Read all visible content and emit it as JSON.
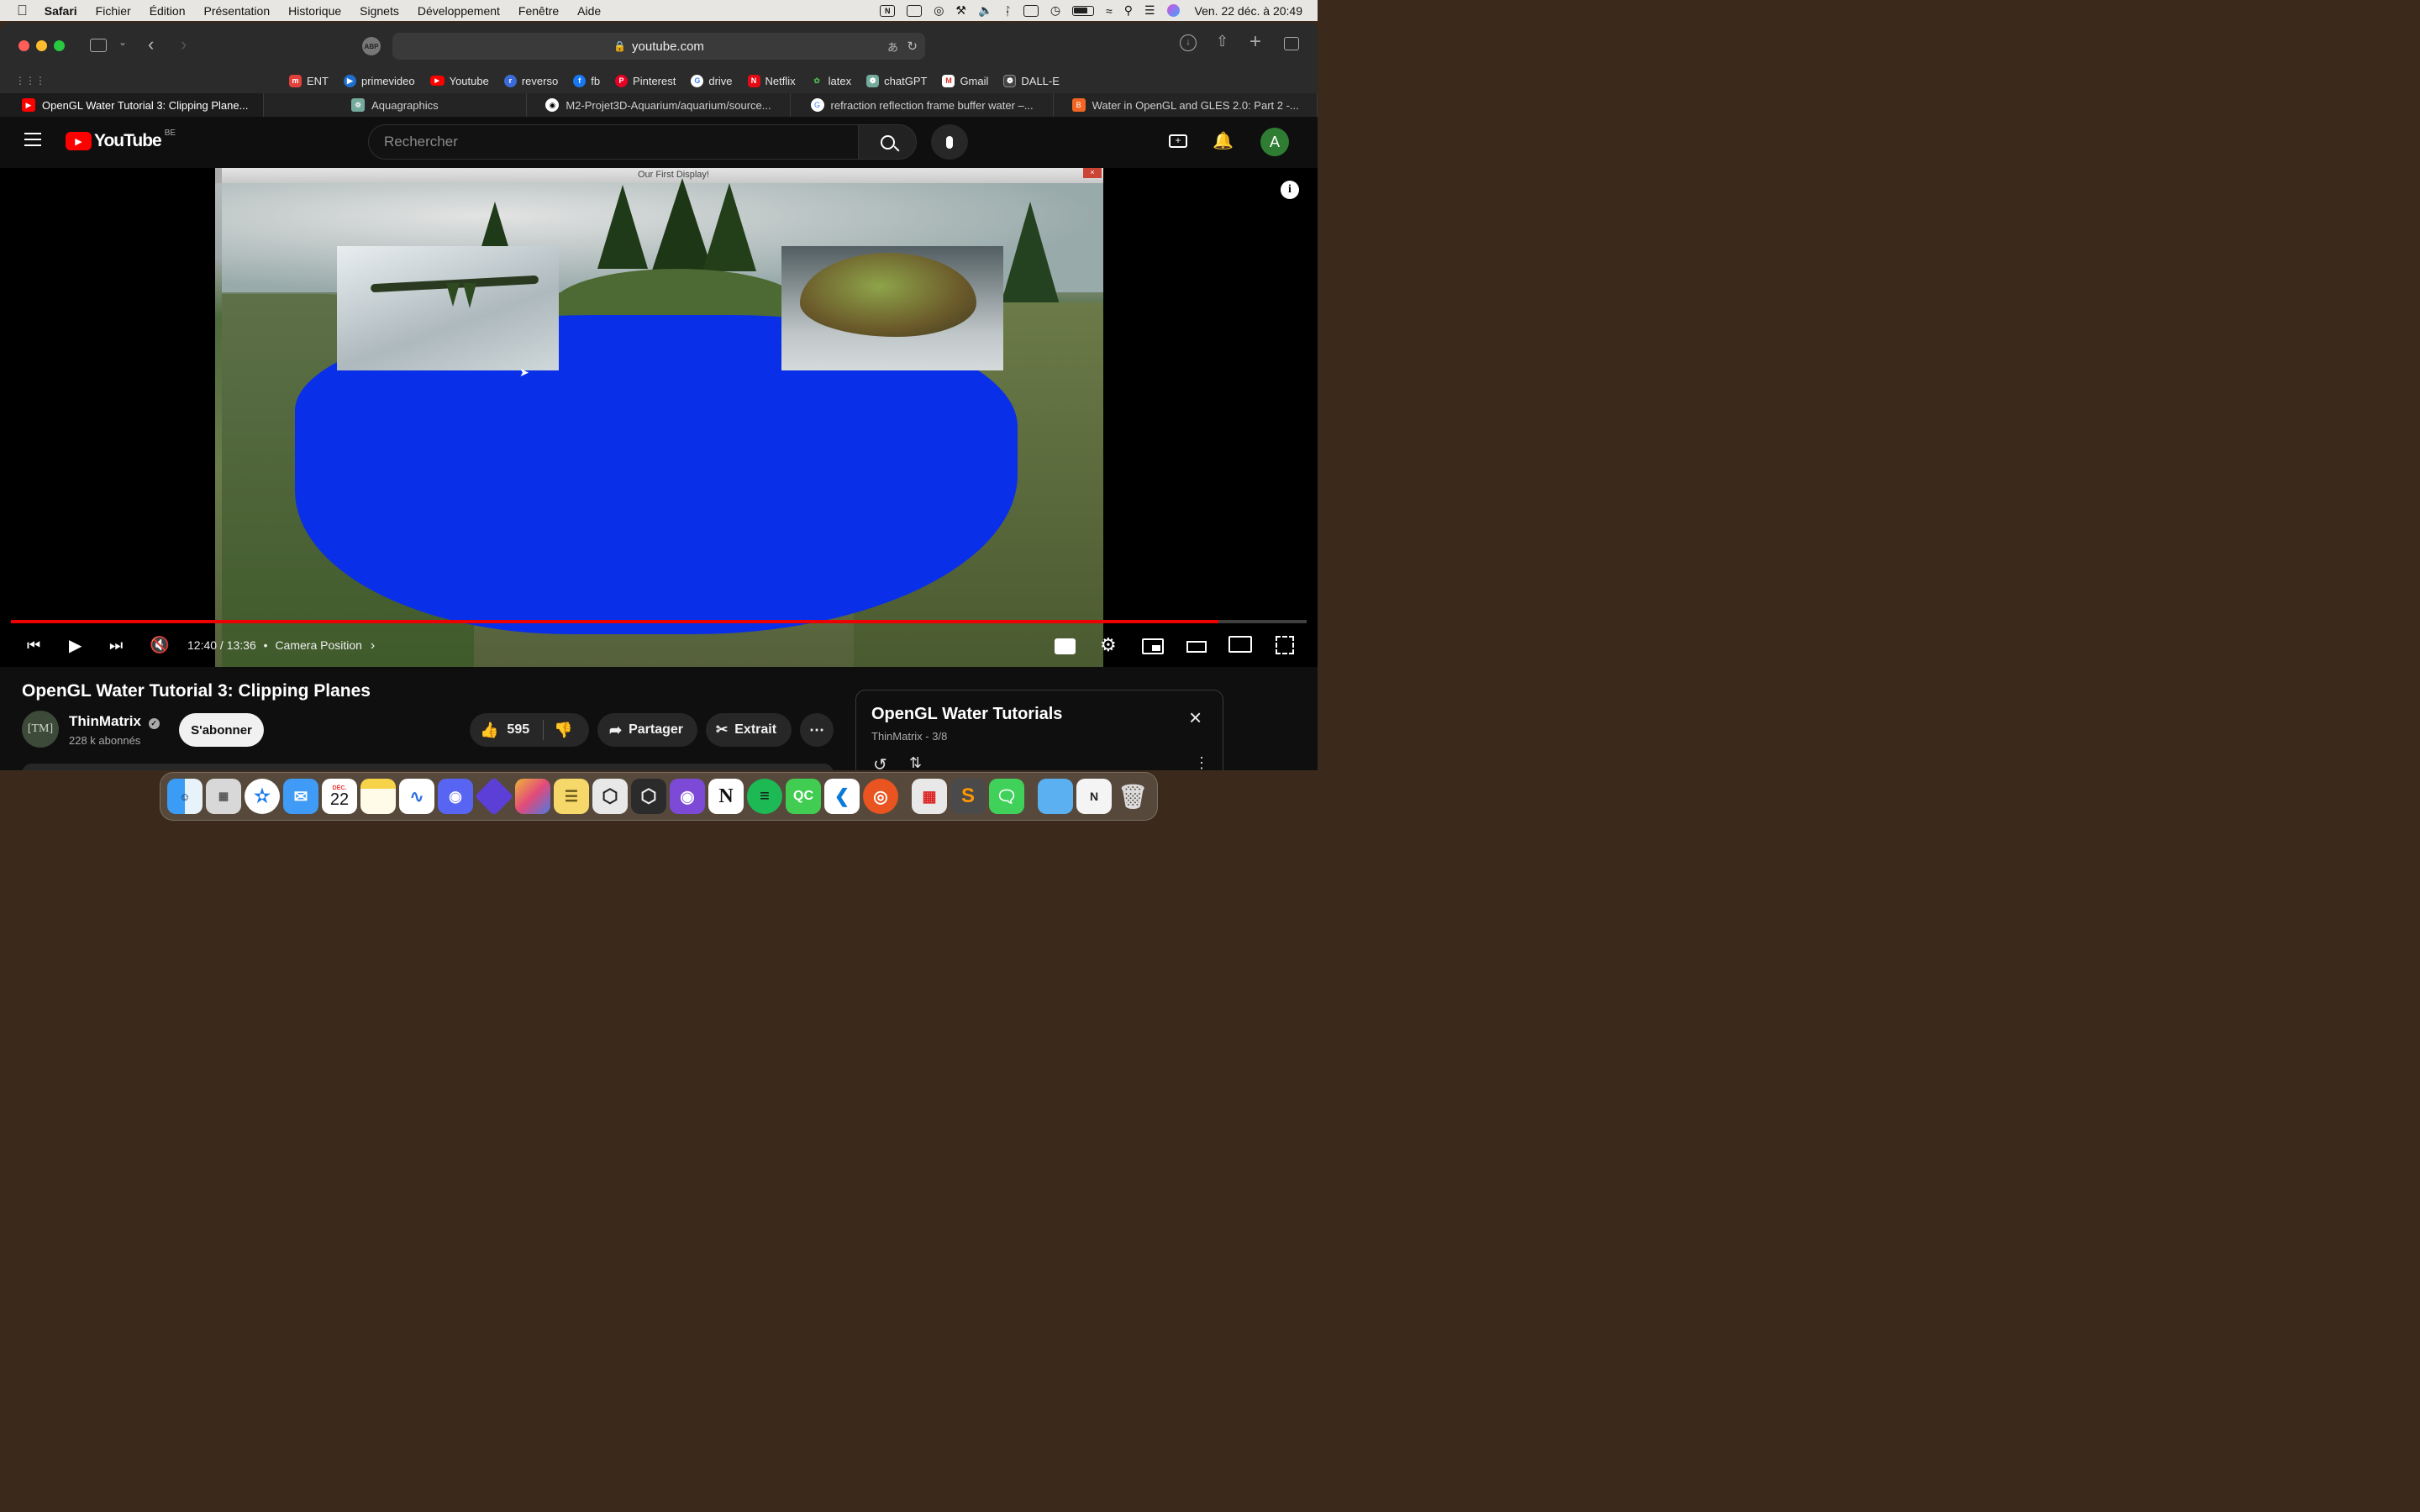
{
  "menubar": {
    "app_name": "Safari",
    "menus": [
      "Fichier",
      "Édition",
      "Présentation",
      "Historique",
      "Signets",
      "Développement",
      "Fenêtre",
      "Aide"
    ],
    "clock": "Ven. 22 déc. à 20:49"
  },
  "browser": {
    "url": "youtube.com",
    "bookmarks": [
      {
        "label": "ENT",
        "color": "#e0413a"
      },
      {
        "label": "primevideo",
        "color": "#1f6fd1"
      },
      {
        "label": "Youtube",
        "color": "#ff0000"
      },
      {
        "label": "reverso",
        "color": "#3b6bd9"
      },
      {
        "label": "fb",
        "color": "#1877f2"
      },
      {
        "label": "Pinterest",
        "color": "#e60023"
      },
      {
        "label": "drive",
        "color": "#4285f4"
      },
      {
        "label": "Netflix",
        "color": "#e50914"
      },
      {
        "label": "latex",
        "color": "#3a8a3a"
      },
      {
        "label": "chatGPT",
        "color": "#74aa9c"
      },
      {
        "label": "Gmail",
        "color": "#d93025"
      },
      {
        "label": "DALL-E",
        "color": "#444444"
      }
    ],
    "tabs": [
      {
        "title": "OpenGL Water Tutorial 3: Clipping Plane...",
        "color": "#ff0000",
        "active": true
      },
      {
        "title": "Aquagraphics",
        "color": "#74aa9c",
        "active": false
      },
      {
        "title": "M2-Projet3D-Aquarium/aquarium/source...",
        "color": "#ffffff",
        "active": false
      },
      {
        "title": "refraction reflection frame buffer water –...",
        "color": "#4285f4",
        "active": false
      },
      {
        "title": "Water in OpenGL and GLES 2.0: Part 2 -...",
        "color": "#f26522",
        "active": false
      }
    ]
  },
  "youtube": {
    "logo_text": "YouTube",
    "region": "BE",
    "search_placeholder": "Rechercher",
    "avatar_letter": "A",
    "player": {
      "window_title": "Our First Display!",
      "time": "12:40 / 13:36",
      "chapter": "Camera Position",
      "progress_fraction": 0.932
    },
    "video_title": "OpenGL Water Tutorial 3: Clipping Planes",
    "channel": {
      "name": "ThinMatrix",
      "subscribers": "228 k abonnés",
      "avatar_text": "[TM]",
      "subscribe_label": "S'abonner"
    },
    "actions": {
      "likes": "595",
      "share_label": "Partager",
      "clip_label": "Extrait"
    },
    "playlist": {
      "title": "OpenGL Water Tutorials",
      "subtitle": "ThinMatrix - 3/8"
    }
  },
  "dock": {
    "calendar_month": "DÉC.",
    "calendar_day": "22"
  }
}
